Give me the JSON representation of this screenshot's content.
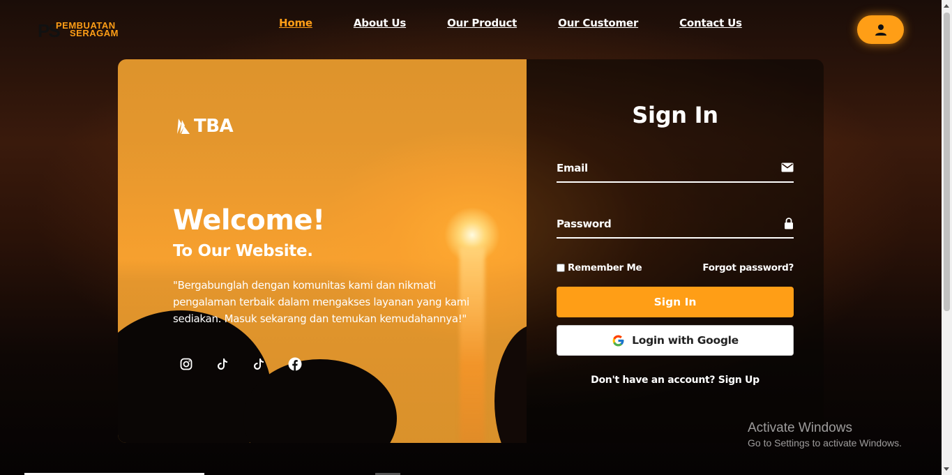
{
  "header": {
    "logo": {
      "mark": "PS",
      "line1": "PEMBUATAN",
      "line2": "SERAGAM"
    },
    "nav": [
      {
        "label": "Home",
        "active": true
      },
      {
        "label": "About Us",
        "active": false
      },
      {
        "label": "Our Product",
        "active": false
      },
      {
        "label": "Our Customer",
        "active": false
      },
      {
        "label": "Contact Us",
        "active": false
      }
    ],
    "user_icon": "user-icon"
  },
  "hero": {
    "brand": "TBA",
    "welcome": "Welcome!",
    "subtitle": "To Our Website.",
    "quote": "\"Bergabunglah dengan komunitas kami dan nikmati pengalaman terbaik dalam mengakses layanan yang kami sediakan. Masuk sekarang dan temukan kemudahannya!\"",
    "socials": [
      "instagram-icon",
      "tiktok-icon",
      "tiktok-icon",
      "facebook-icon"
    ]
  },
  "form": {
    "title": "Sign In",
    "email_placeholder": "Email",
    "password_placeholder": "Password",
    "remember_label": "Remember Me",
    "forgot_label": "Forgot password?",
    "signin_label": "Sign In",
    "google_label": "Login with Google",
    "signup_prompt": "Don't have an account?",
    "signup_link": "Sign Up"
  },
  "watermark": {
    "title": "Activate Windows",
    "subtitle": "Go to Settings to activate Windows."
  },
  "colors": {
    "accent": "#ff9e16",
    "text": "#ffffff"
  }
}
